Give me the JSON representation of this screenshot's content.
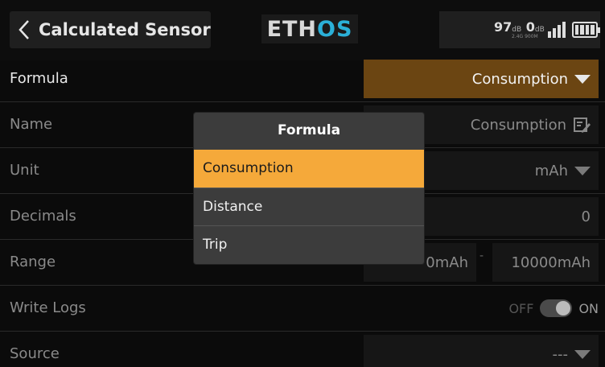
{
  "header": {
    "title": "Calculated Sensor",
    "logo_main": "ETH",
    "logo_accent": "OS",
    "rssi_value": "97",
    "rssi_unit": "dB",
    "rssi_value2": "0",
    "rssi_unit2": "dB",
    "rssi_sub": "2.4G 900M"
  },
  "rows": {
    "formula": {
      "label": "Formula",
      "value": "Consumption"
    },
    "name": {
      "label": "Name",
      "value": "Consumption"
    },
    "unit": {
      "label": "Unit",
      "value": "mAh"
    },
    "decimals": {
      "label": "Decimals",
      "value": "0"
    },
    "range": {
      "label": "Range",
      "min": "0mAh",
      "sep": "-",
      "max": "10000mAh"
    },
    "write_logs": {
      "label": "Write Logs",
      "off": "OFF",
      "on": "ON",
      "state": "on"
    },
    "source": {
      "label": "Source",
      "value": "---"
    }
  },
  "popup": {
    "title": "Formula",
    "items": [
      "Consumption",
      "Distance",
      "Trip"
    ],
    "selected_index": 0
  },
  "colors": {
    "accent_orange": "#f5a93a",
    "selected_field": "#6b4512",
    "logo_accent": "#2bb0d8"
  },
  "icons": {
    "back": "chevron-left-icon",
    "edit": "edit-icon",
    "dropdown": "triangle-down-icon",
    "signal": "signal-bars-icon",
    "battery": "battery-icon"
  }
}
